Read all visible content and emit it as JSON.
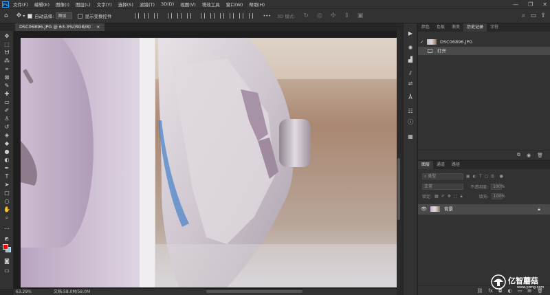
{
  "menu": {
    "logo": "Ps",
    "items": [
      "文件(F)",
      "编辑(E)",
      "图像(I)",
      "图层(L)",
      "文字(Y)",
      "选择(S)",
      "滤镜(T)",
      "3D(D)",
      "视图(V)",
      "增效工具",
      "窗口(W)",
      "帮助(H)"
    ],
    "window_controls": [
      "—",
      "❐",
      "✕"
    ]
  },
  "options": {
    "auto_select_label": "自动选择:",
    "auto_select_value": "图层",
    "show_transform_label": "显示变换控件",
    "mode_3d_label": "3D 模式:",
    "more": "•••"
  },
  "document": {
    "tab_title": "DSC06896.JPG @ 63.3%(RGB/8)",
    "close": "×"
  },
  "status": {
    "zoom": "63.29%",
    "doc_size": "文档:58.0M/58.0M"
  },
  "history_panel": {
    "tabs": [
      "颜色",
      "色板",
      "渐变",
      "历史记录",
      "字符"
    ],
    "active_tab": "历史记录",
    "snapshot_name": "DSC06896.JPG",
    "steps": [
      "打开"
    ]
  },
  "layers_panel": {
    "tabs": [
      "图层",
      "通道",
      "路径"
    ],
    "active_tab": "图层",
    "filter_placeholder": "类型",
    "blend_mode": "正常",
    "opacity_label": "不透明度:",
    "opacity_value": "100%",
    "lock_label": "锁定:",
    "fill_label": "填充:",
    "fill_value": "100%",
    "layers": [
      {
        "name": "背景",
        "visible": true,
        "locked": true
      }
    ]
  },
  "watermark": {
    "text": "亿智蘑菇",
    "url": "www.yzmg.com"
  },
  "colors": {
    "foreground": "#ff0000",
    "background": "#7ec8e3",
    "accent": "#31a8ff"
  }
}
